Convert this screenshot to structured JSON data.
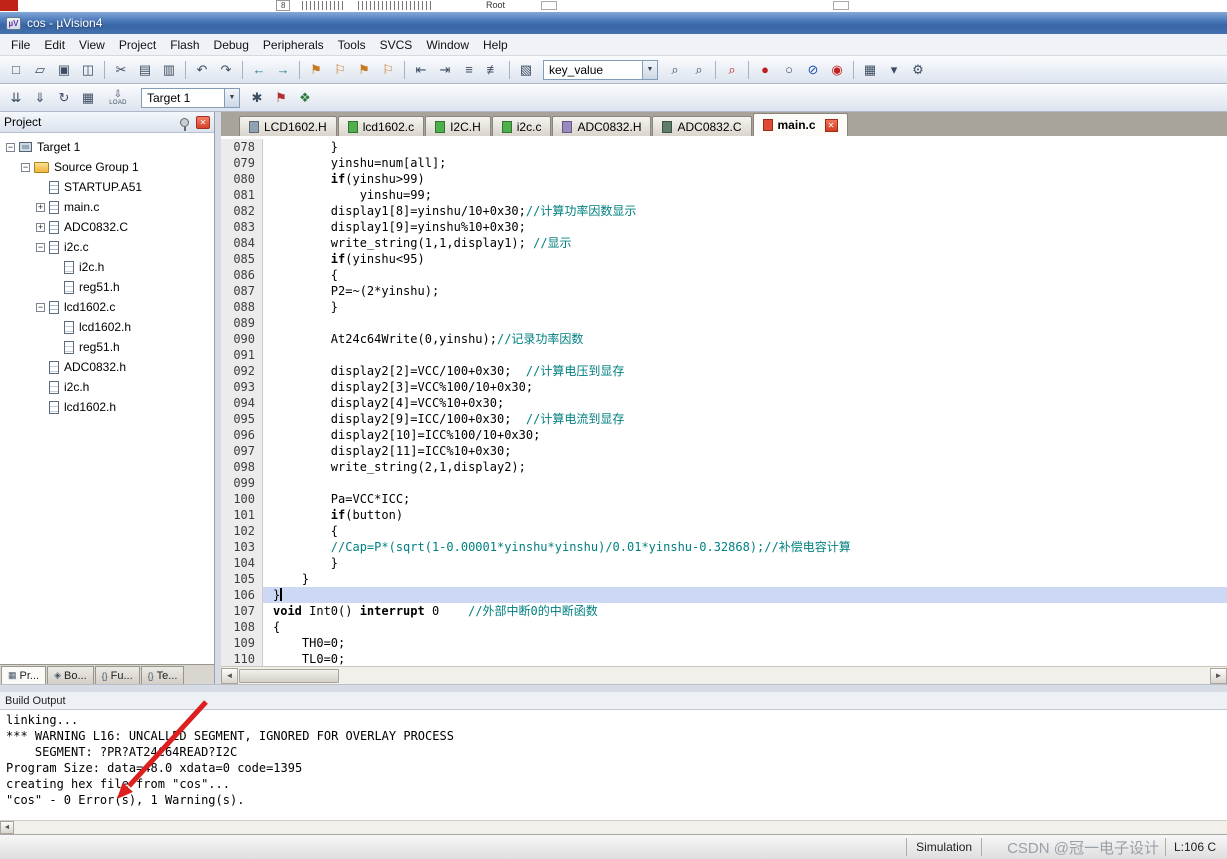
{
  "window": {
    "title": "cos - µVision4",
    "app_icon": "µV"
  },
  "artifact": {
    "label_8": "8",
    "label_root": "Root"
  },
  "icons": {
    "dropdown": "▼",
    "scroll_left": "◄",
    "scroll_right": "►",
    "close": "✕"
  },
  "menu": {
    "items": [
      "File",
      "Edit",
      "View",
      "Project",
      "Flash",
      "Debug",
      "Peripherals",
      "Tools",
      "SVCS",
      "Window",
      "Help"
    ]
  },
  "toolbar_main": {
    "search_value": "key_value",
    "icons_left": [
      {
        "name": "new-file",
        "glyph": "□"
      },
      {
        "name": "open-file",
        "glyph": "▱"
      },
      {
        "name": "save",
        "glyph": "▣"
      },
      {
        "name": "save-all",
        "glyph": "◫"
      },
      {
        "sep": true
      },
      {
        "name": "cut",
        "glyph": "✂"
      },
      {
        "name": "copy",
        "glyph": "▤"
      },
      {
        "name": "paste",
        "glyph": "▥"
      },
      {
        "sep": true
      },
      {
        "name": "undo",
        "glyph": "↶"
      },
      {
        "name": "redo",
        "glyph": "↷"
      },
      {
        "sep": true
      },
      {
        "name": "navigate-back",
        "glyph": "←",
        "color": "#1d7a8c"
      },
      {
        "name": "navigate-forward",
        "glyph": "→",
        "color": "#1d7a8c"
      },
      {
        "sep": true
      },
      {
        "name": "bookmark-toggle",
        "glyph": "⚑",
        "color": "#c87a20"
      },
      {
        "name": "bookmark-prev",
        "glyph": "⚐",
        "color": "#c87a20"
      },
      {
        "name": "bookmark-next",
        "glyph": "⚑",
        "color": "#c87a20"
      },
      {
        "name": "bookmark-clear",
        "glyph": "⚐",
        "color": "#c87a20"
      },
      {
        "sep": true
      },
      {
        "name": "outdent",
        "glyph": "⇤"
      },
      {
        "name": "indent",
        "glyph": "⇥"
      },
      {
        "name": "comment",
        "glyph": "≡"
      },
      {
        "name": "uncomment",
        "glyph": "≢"
      },
      {
        "sep": true
      },
      {
        "name": "edit-marker",
        "glyph": "▧"
      }
    ],
    "icons_right": [
      {
        "name": "find-next",
        "glyph": "⌕"
      },
      {
        "name": "find-in-files",
        "glyph": "⌕"
      },
      {
        "sep": true
      },
      {
        "name": "find",
        "glyph": "⌕",
        "color": "#b02525"
      },
      {
        "sep": true
      },
      {
        "name": "insert-breakpoint",
        "glyph": "●",
        "color": "#c02020"
      },
      {
        "name": "enable-breakpoint",
        "glyph": "○"
      },
      {
        "name": "disable-all-breakpoints",
        "glyph": "⊘",
        "color": "#2050b0"
      },
      {
        "name": "kill-all-breakpoints",
        "glyph": "◉",
        "color": "#c02020"
      },
      {
        "sep": true
      },
      {
        "name": "debug-windows",
        "glyph": "▦"
      },
      {
        "name": "windows-dropdown",
        "glyph": "▾"
      },
      {
        "name": "configure",
        "glyph": "⚙"
      }
    ]
  },
  "toolbar_build": {
    "load_label": "LOAD",
    "load_glyph": "⇩",
    "target_value": "Target 1",
    "icons_left": [
      {
        "name": "translate",
        "glyph": "⇊"
      },
      {
        "name": "build",
        "glyph": "⇓"
      },
      {
        "name": "rebuild",
        "glyph": "↻"
      },
      {
        "name": "batch-build",
        "glyph": "▦"
      }
    ],
    "icons_right": [
      {
        "name": "options-for-target",
        "glyph": "✱"
      },
      {
        "name": "flag",
        "glyph": "⚑",
        "color": "#b03030"
      },
      {
        "name": "manage-components",
        "glyph": "❖",
        "color": "#2a7a3a"
      }
    ]
  },
  "project": {
    "header": "Project",
    "tree": [
      {
        "level": 0,
        "exp": "-",
        "icon": "target",
        "label": "Target 1"
      },
      {
        "level": 1,
        "exp": "-",
        "icon": "folder",
        "label": "Source Group 1"
      },
      {
        "level": 2,
        "exp": "",
        "icon": "doc",
        "label": "STARTUP.A51"
      },
      {
        "level": 2,
        "exp": "+",
        "icon": "doc",
        "label": "main.c"
      },
      {
        "level": 2,
        "exp": "+",
        "icon": "doc",
        "label": "ADC0832.C"
      },
      {
        "level": 2,
        "exp": "-",
        "icon": "doc",
        "label": "i2c.c"
      },
      {
        "level": 3,
        "exp": "",
        "icon": "doc2",
        "label": "i2c.h"
      },
      {
        "level": 3,
        "exp": "",
        "icon": "doc2",
        "label": "reg51.h"
      },
      {
        "level": 2,
        "exp": "-",
        "icon": "doc",
        "label": "lcd1602.c"
      },
      {
        "level": 3,
        "exp": "",
        "icon": "doc2",
        "label": "lcd1602.h"
      },
      {
        "level": 3,
        "exp": "",
        "icon": "doc2",
        "label": "reg51.h"
      },
      {
        "level": 2,
        "exp": "",
        "icon": "doc2",
        "label": "ADC0832.h"
      },
      {
        "level": 2,
        "exp": "",
        "icon": "doc2",
        "label": "i2c.h"
      },
      {
        "level": 2,
        "exp": "",
        "icon": "doc2",
        "label": "lcd1602.h"
      }
    ],
    "bottom_tabs": [
      {
        "glyph": "▦",
        "label": "Pr...",
        "active": true
      },
      {
        "glyph": "◈",
        "label": "Bo...",
        "active": false
      },
      {
        "glyph": "{}",
        "label": "Fu...",
        "active": false
      },
      {
        "glyph": "{}",
        "label": "Te...",
        "active": false
      }
    ]
  },
  "editor": {
    "tabs": [
      {
        "label": "LCD1602.H",
        "color": "#8fa3b5",
        "active": false
      },
      {
        "label": "lcd1602.c",
        "color": "#4db04d",
        "active": false
      },
      {
        "label": "I2C.H",
        "color": "#4db04d",
        "active": false
      },
      {
        "label": "i2c.c",
        "color": "#4db04d",
        "active": false
      },
      {
        "label": "ADC0832.H",
        "color": "#9b8ac2",
        "active": false
      },
      {
        "label": "ADC0832.C",
        "color": "#5f7d68",
        "active": false
      },
      {
        "label": "main.c",
        "color": "#e04a32",
        "active": true
      }
    ],
    "lines": [
      {
        "num": "078",
        "segs": [
          {
            "t": "        }",
            "s": "c"
          }
        ]
      },
      {
        "num": "079",
        "segs": [
          {
            "t": "        yinshu=num[all];",
            "s": "c"
          }
        ]
      },
      {
        "num": "080",
        "segs": [
          {
            "t": "        ",
            "s": "c"
          },
          {
            "t": "if",
            "s": "k"
          },
          {
            "t": "(yinshu>99)",
            "s": "c"
          }
        ]
      },
      {
        "num": "081",
        "segs": [
          {
            "t": "            yinshu=99;",
            "s": "c"
          }
        ]
      },
      {
        "num": "082",
        "segs": [
          {
            "t": "        display1[8]=yinshu/10+0x30;",
            "s": "c"
          },
          {
            "t": "//计算功率因数显示",
            "s": "m"
          }
        ]
      },
      {
        "num": "083",
        "segs": [
          {
            "t": "        display1[9]=yinshu%10+0x30;",
            "s": "c"
          }
        ]
      },
      {
        "num": "084",
        "segs": [
          {
            "t": "        write_string(1,1,display1); ",
            "s": "c"
          },
          {
            "t": "//显示",
            "s": "m"
          }
        ]
      },
      {
        "num": "085",
        "segs": [
          {
            "t": "        ",
            "s": "c"
          },
          {
            "t": "if",
            "s": "k"
          },
          {
            "t": "(yinshu<95)",
            "s": "c"
          }
        ]
      },
      {
        "num": "086",
        "segs": [
          {
            "t": "        {",
            "s": "c"
          }
        ]
      },
      {
        "num": "087",
        "segs": [
          {
            "t": "        P2=~(2*yinshu);",
            "s": "c"
          }
        ]
      },
      {
        "num": "088",
        "segs": [
          {
            "t": "        }",
            "s": "c"
          }
        ]
      },
      {
        "num": "089",
        "segs": []
      },
      {
        "num": "090",
        "segs": [
          {
            "t": "        At24c64Write(0,yinshu);",
            "s": "c"
          },
          {
            "t": "//记录功率因数",
            "s": "m"
          }
        ]
      },
      {
        "num": "091",
        "segs": []
      },
      {
        "num": "092",
        "segs": [
          {
            "t": "        display2[2]=VCC/100+0x30;  ",
            "s": "c"
          },
          {
            "t": "//计算电压到显存",
            "s": "m"
          }
        ]
      },
      {
        "num": "093",
        "segs": [
          {
            "t": "        display2[3]=VCC%100/10+0x30;",
            "s": "c"
          }
        ]
      },
      {
        "num": "094",
        "segs": [
          {
            "t": "        display2[4]=VCC%10+0x30;",
            "s": "c"
          }
        ]
      },
      {
        "num": "095",
        "segs": [
          {
            "t": "        display2[9]=ICC/100+0x30;  ",
            "s": "c"
          },
          {
            "t": "//计算电流到显存",
            "s": "m"
          }
        ]
      },
      {
        "num": "096",
        "segs": [
          {
            "t": "        display2[10]=ICC%100/10+0x30;",
            "s": "c"
          }
        ]
      },
      {
        "num": "097",
        "segs": [
          {
            "t": "        display2[11]=ICC%10+0x30;",
            "s": "c"
          }
        ]
      },
      {
        "num": "098",
        "segs": [
          {
            "t": "        write_string(2,1,display2);",
            "s": "c"
          }
        ]
      },
      {
        "num": "099",
        "segs": []
      },
      {
        "num": "100",
        "segs": [
          {
            "t": "        Pa=VCC*ICC;",
            "s": "c"
          }
        ]
      },
      {
        "num": "101",
        "segs": [
          {
            "t": "        ",
            "s": "c"
          },
          {
            "t": "if",
            "s": "k"
          },
          {
            "t": "(button)",
            "s": "c"
          }
        ]
      },
      {
        "num": "102",
        "segs": [
          {
            "t": "        {",
            "s": "c"
          }
        ]
      },
      {
        "num": "103",
        "segs": [
          {
            "t": "        ",
            "s": "c"
          },
          {
            "t": "//Cap=P*(sqrt(1-0.00001*yinshu*yinshu)/0.01*yinshu-0.32868);//补偿电容计算",
            "s": "m"
          }
        ]
      },
      {
        "num": "104",
        "segs": [
          {
            "t": "        }",
            "s": "c"
          }
        ]
      },
      {
        "num": "105",
        "segs": [
          {
            "t": "    }",
            "s": "c"
          }
        ]
      },
      {
        "num": "106",
        "segs": [
          {
            "t": "}",
            "s": "c"
          }
        ],
        "hl": true,
        "caret": true
      },
      {
        "num": "107",
        "segs": [
          {
            "t": "void",
            "s": "k"
          },
          {
            "t": " Int0() ",
            "s": "c"
          },
          {
            "t": "interrupt",
            "s": "k"
          },
          {
            "t": " 0    ",
            "s": "c"
          },
          {
            "t": "//外部中断0的中断函数",
            "s": "m"
          }
        ]
      },
      {
        "num": "108",
        "segs": [
          {
            "t": "{",
            "s": "c"
          }
        ]
      },
      {
        "num": "109",
        "segs": [
          {
            "t": "    TH0=0;",
            "s": "c"
          }
        ]
      },
      {
        "num": "110",
        "segs": [
          {
            "t": "    TL0=0;",
            "s": "c"
          }
        ]
      }
    ]
  },
  "build": {
    "header": "Build Output",
    "lines": [
      "linking...",
      "*** WARNING L16: UNCALLED SEGMENT, IGNORED FOR OVERLAY PROCESS",
      "    SEGMENT: ?PR?AT24C64READ?I2C",
      "Program Size: data=48.0 xdata=0 code=1395",
      "creating hex file from \"cos\"...",
      "\"cos\" - 0 Error(s), 1 Warning(s)."
    ]
  },
  "status": {
    "simulation": "Simulation",
    "watermark": "CSDN @冠一电子设计",
    "position": "L:106 C"
  }
}
